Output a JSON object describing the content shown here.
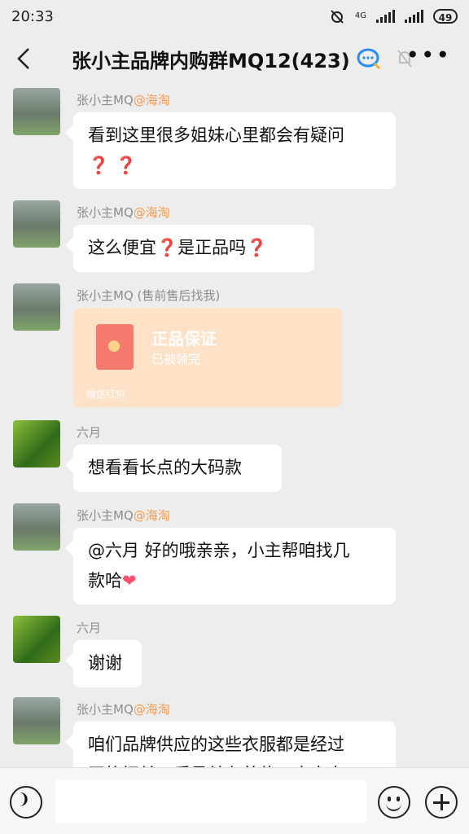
{
  "status_bar": {
    "time": "20:33",
    "network": "4G",
    "battery": "49"
  },
  "header": {
    "title": "张小主品牌内购群MQ12(423)",
    "back_icon": "chevron-left-icon",
    "more_icon": "ellipsis-icon"
  },
  "messages": [
    {
      "sender": "张小主MQ",
      "tag": "@海淘",
      "avatar": "woman",
      "text": "看到这里很多姐妹心里都会有疑问",
      "line2": "❓ ❓"
    },
    {
      "sender": "张小主MQ",
      "tag": "@海淘",
      "avatar": "woman",
      "text_a": "这么便宜",
      "text_b": "是正品吗"
    },
    {
      "sender": "张小主MQ (售前售后找我)",
      "avatar": "woman",
      "red_packet": {
        "title": "正品保证",
        "status": "已被领完",
        "footer": "微信红包"
      }
    },
    {
      "sender": "六月",
      "avatar": "ant",
      "text": "想看看长点的大码款"
    },
    {
      "sender": "张小主MQ",
      "tag": "@海淘",
      "avatar": "woman",
      "text": "@六月 好的哦亲亲，小主帮咱找几",
      "line2": "款哈"
    },
    {
      "sender": "六月",
      "avatar": "ant",
      "text": "谢谢"
    },
    {
      "sender": "张小主MQ",
      "tag": "@海淘",
      "avatar": "woman",
      "text": "咱们品牌供应的这些衣服都是经过",
      "line2": "严格把关，质量关有着位，大家自"
    }
  ],
  "input": {
    "placeholder": ""
  },
  "colors": {
    "background": "#ededed",
    "bubble": "#ffffff",
    "tag": "#f39b4b",
    "red_packet": "#fde2c7"
  }
}
